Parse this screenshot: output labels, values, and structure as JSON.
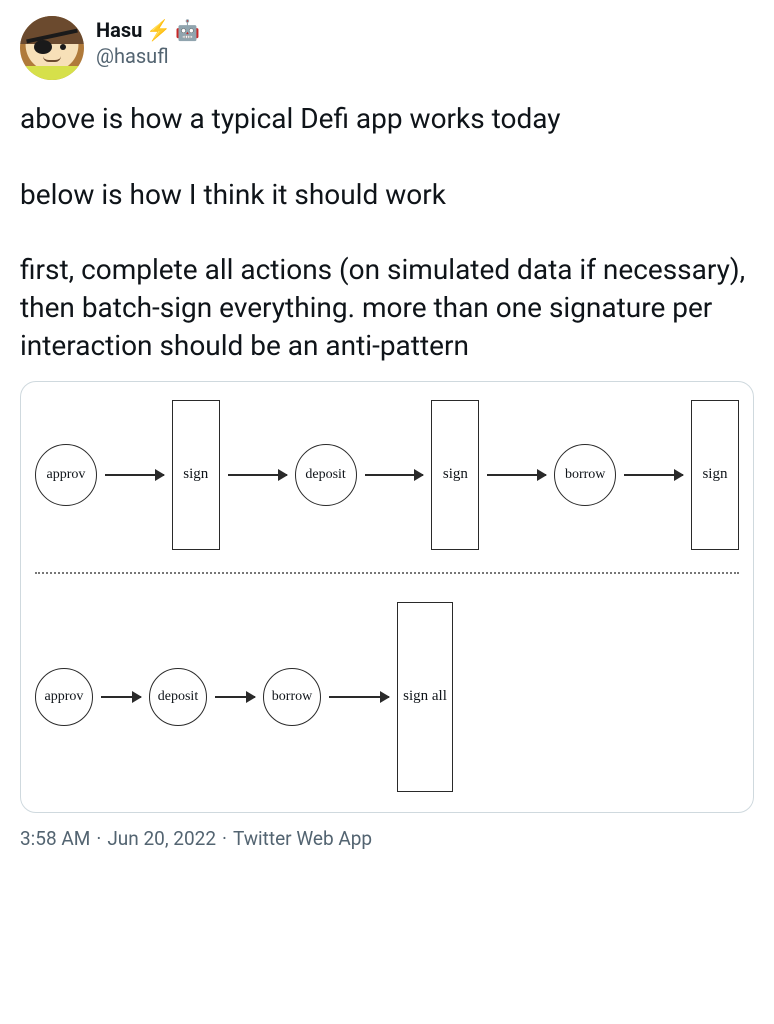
{
  "author": {
    "display_name": "Hasu",
    "emoji1": "⚡",
    "emoji2": "🤖",
    "handle": "@hasufl"
  },
  "body": "above is how a typical Defi app works today\n\nbelow is how I think it should work\n\nfirst, complete all actions (on simulated data if necessary), then batch-sign everything. more than one signature per interaction should be an anti-pattern",
  "diagram": {
    "top_flow": [
      "approv",
      "sign",
      "deposit",
      "sign",
      "borrow",
      "sign"
    ],
    "bottom_flow": [
      "approv",
      "deposit",
      "borrow",
      "sign\nall"
    ]
  },
  "meta": {
    "time": "3:58 AM",
    "date": "Jun 20, 2022",
    "source": "Twitter Web App"
  }
}
